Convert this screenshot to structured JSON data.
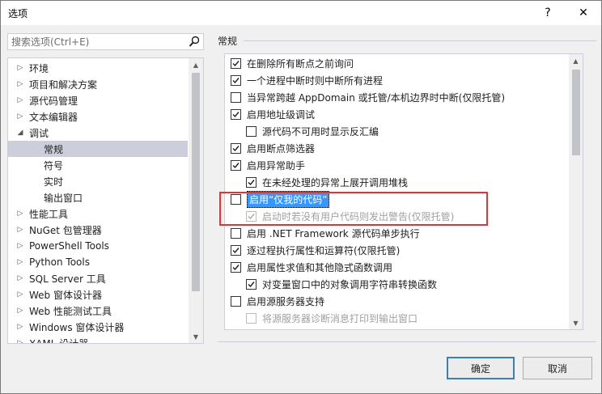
{
  "window": {
    "title": "选项",
    "help_label": "?",
    "close_label": "✕"
  },
  "search": {
    "placeholder": "搜索选项(Ctrl+E)"
  },
  "tree": {
    "items": [
      {
        "label": "环境",
        "expander": "▷"
      },
      {
        "label": "项目和解决方案",
        "expander": "▷"
      },
      {
        "label": "源代码管理",
        "expander": "▷"
      },
      {
        "label": "文本编辑器",
        "expander": "▷"
      },
      {
        "label": "调试",
        "expander": "◢"
      },
      {
        "label": "常规",
        "expander": ""
      },
      {
        "label": "符号",
        "expander": ""
      },
      {
        "label": "实时",
        "expander": ""
      },
      {
        "label": "输出窗口",
        "expander": ""
      },
      {
        "label": "性能工具",
        "expander": "▷"
      },
      {
        "label": "NuGet 包管理器",
        "expander": "▷"
      },
      {
        "label": "PowerShell Tools",
        "expander": "▷"
      },
      {
        "label": "Python Tools",
        "expander": "▷"
      },
      {
        "label": "SQL Server 工具",
        "expander": "▷"
      },
      {
        "label": "Web 窗体设计器",
        "expander": "▷"
      },
      {
        "label": "Web 性能测试工具",
        "expander": "▷"
      },
      {
        "label": "Windows 窗体设计器",
        "expander": "▷"
      },
      {
        "label": "XAML 设计器",
        "expander": "▷"
      }
    ],
    "selected": "常规"
  },
  "section": {
    "title": "常规"
  },
  "options": [
    {
      "label": "在删除所有断点之前询问",
      "checked": true,
      "indent": 0,
      "enabled": true
    },
    {
      "label": "一个进程中断时则中断所有进程",
      "checked": true,
      "indent": 0,
      "enabled": true
    },
    {
      "label": "当异常跨越 AppDomain 或托管/本机边界时中断(仅限托管)",
      "checked": false,
      "indent": 0,
      "enabled": true
    },
    {
      "label": "启用地址级调试",
      "checked": true,
      "indent": 0,
      "enabled": true
    },
    {
      "label": "源代码不可用时显示反汇编",
      "checked": false,
      "indent": 1,
      "enabled": true
    },
    {
      "label": "启用断点筛选器",
      "checked": true,
      "indent": 0,
      "enabled": true
    },
    {
      "label": "启用异常助手",
      "checked": true,
      "indent": 0,
      "enabled": true
    },
    {
      "label": "在未经处理的异常上展开调用堆栈",
      "checked": true,
      "indent": 1,
      "enabled": true
    },
    {
      "label": "启用“仅我的代码”",
      "checked": false,
      "indent": 0,
      "enabled": true,
      "highlighted": true
    },
    {
      "label": "启动时若没有用户代码则发出警告(仅限托管)",
      "checked": true,
      "indent": 1,
      "enabled": false
    },
    {
      "label": "启用 .NET Framework 源代码单步执行",
      "checked": false,
      "indent": 0,
      "enabled": true
    },
    {
      "label": "逐过程执行属性和运算符(仅限托管)",
      "checked": true,
      "indent": 0,
      "enabled": true
    },
    {
      "label": "启用属性求值和其他隐式函数调用",
      "checked": true,
      "indent": 0,
      "enabled": true
    },
    {
      "label": "对变量窗口中的对象调用字符串转换函数",
      "checked": true,
      "indent": 1,
      "enabled": true
    },
    {
      "label": "启用源服务器支持",
      "checked": false,
      "indent": 0,
      "enabled": true
    },
    {
      "label": "将源服务器诊断消息打印到输出窗口",
      "checked": false,
      "indent": 1,
      "enabled": false
    }
  ],
  "buttons": {
    "ok": "确定",
    "cancel": "取消"
  },
  "colors": {
    "annotation_box": "#e8303a",
    "selection_highlight": "#3399ff",
    "tree_selected": "#cccedb"
  }
}
